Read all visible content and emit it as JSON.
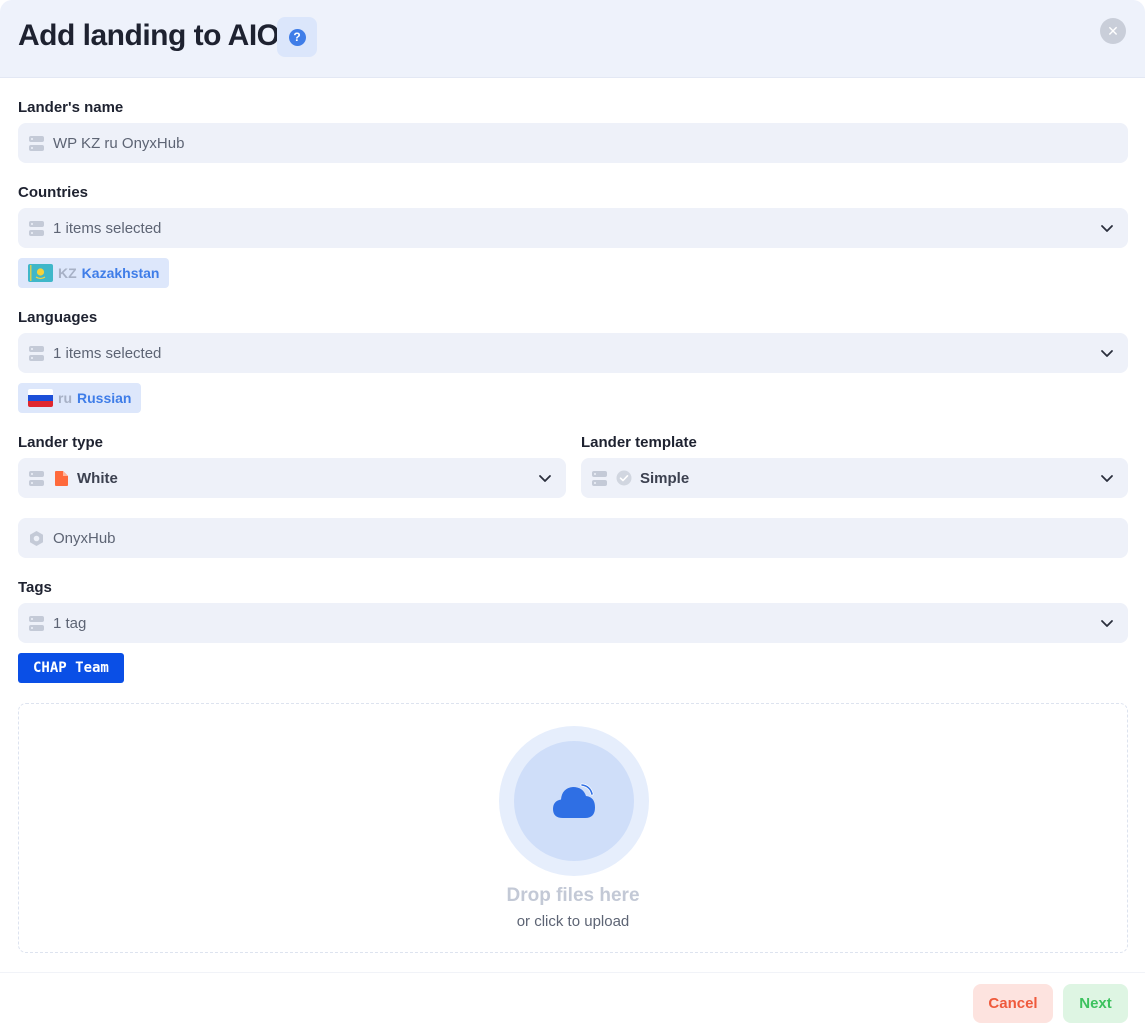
{
  "dialog": {
    "title": "Add landing to AIO",
    "help_icon": "question-icon",
    "close_icon": "close-icon"
  },
  "lander_name": {
    "label": "Lander's name",
    "value": "WP KZ ru OnyxHub"
  },
  "countries": {
    "label": "Countries",
    "value": "1 items selected",
    "selected": [
      {
        "code": "KZ",
        "name": "Kazakhstan"
      }
    ]
  },
  "languages": {
    "label": "Languages",
    "value": "1 items selected",
    "selected": [
      {
        "code": "ru",
        "name": "Russian"
      }
    ]
  },
  "lander_type": {
    "label": "Lander type",
    "value": "White",
    "icon": "page-icon",
    "icon_color": "#ff6a3c"
  },
  "lander_template": {
    "label": "Lander template",
    "value": "Simple",
    "icon": "check-circle-icon"
  },
  "team": {
    "value": "OnyxHub",
    "icon": "hexagon-icon"
  },
  "tags": {
    "label": "Tags",
    "value": "1 tag",
    "selected": [
      "CHAP Team"
    ],
    "chip_color": "#0a4fe6"
  },
  "upload": {
    "title": "Drop files here",
    "subtitle": "or click to upload",
    "icon": "cloud-icon",
    "accent": "#2f6fe4"
  },
  "footer": {
    "cancel_label": "Cancel",
    "next_label": "Next"
  },
  "colors": {
    "field_bg": "#eef1f9",
    "header_bg": "#eef2fb",
    "accent_blue": "#3f7de8",
    "cancel_fg": "#ef5a3c",
    "next_fg": "#3cc25e"
  }
}
